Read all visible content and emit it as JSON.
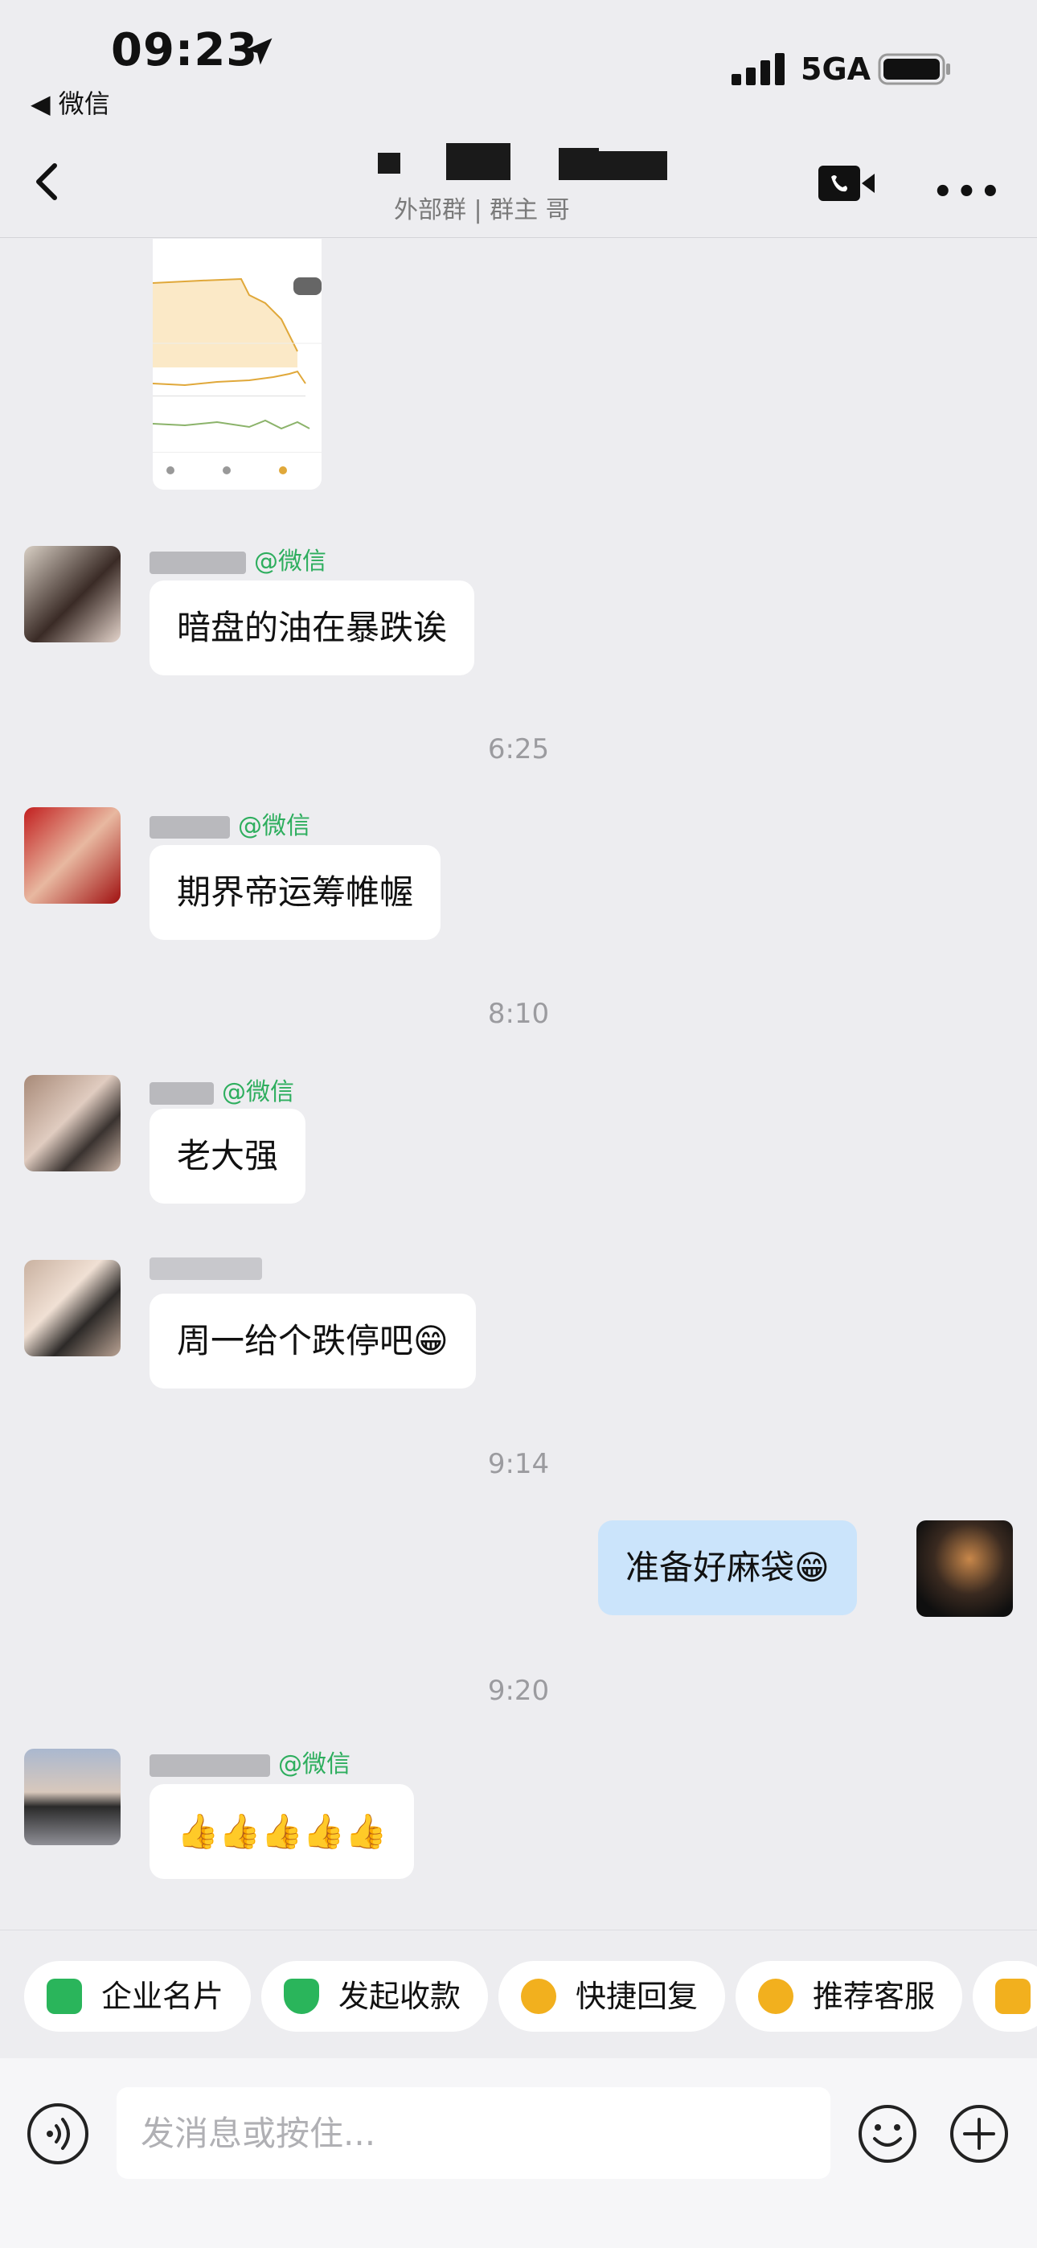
{
  "status_bar": {
    "time": "09:23",
    "back_app": "◀ 微信",
    "network": "5GA"
  },
  "nav": {
    "subtitle": "外部群 | 群主 哥",
    "more": "•••"
  },
  "messages": [
    {
      "sender_suffix": "@微信",
      "text": "暗盘的油在暴跌诶",
      "side": "left"
    },
    {
      "time": "6:25"
    },
    {
      "sender_suffix": "@微信",
      "text": "期界帝运筹帷幄",
      "side": "left"
    },
    {
      "time": "8:10"
    },
    {
      "sender_suffix": "@微信",
      "text": "老大强",
      "side": "left"
    },
    {
      "sender_suffix": "",
      "text": "周一给个跌停吧😁",
      "side": "left"
    },
    {
      "time": "9:14"
    },
    {
      "text": "准备好麻袋😁",
      "side": "right"
    },
    {
      "time": "9:20"
    },
    {
      "sender_suffix": "@微信",
      "text": "👍👍👍👍👍",
      "side": "left"
    }
  ],
  "toolbar": {
    "chips": [
      {
        "label": "企业名片",
        "icon": "business-card-icon",
        "color": "#2ab55b"
      },
      {
        "label": "发起收款",
        "icon": "payment-icon",
        "color": "#2ab55b"
      },
      {
        "label": "快捷回复",
        "icon": "quick-reply-icon",
        "color": "#f2b01e"
      },
      {
        "label": "推荐客服",
        "icon": "service-icon",
        "color": "#f2b01e"
      }
    ],
    "input_placeholder": "发消息或按住..."
  }
}
